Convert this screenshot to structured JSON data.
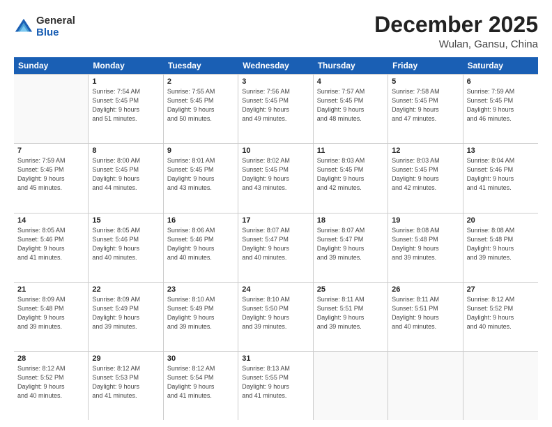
{
  "logo": {
    "general": "General",
    "blue": "Blue"
  },
  "title": "December 2025",
  "location": "Wulan, Gansu, China",
  "days_header": [
    "Sunday",
    "Monday",
    "Tuesday",
    "Wednesday",
    "Thursday",
    "Friday",
    "Saturday"
  ],
  "weeks": [
    [
      {
        "day": "",
        "info": ""
      },
      {
        "day": "1",
        "info": "Sunrise: 7:54 AM\nSunset: 5:45 PM\nDaylight: 9 hours\nand 51 minutes."
      },
      {
        "day": "2",
        "info": "Sunrise: 7:55 AM\nSunset: 5:45 PM\nDaylight: 9 hours\nand 50 minutes."
      },
      {
        "day": "3",
        "info": "Sunrise: 7:56 AM\nSunset: 5:45 PM\nDaylight: 9 hours\nand 49 minutes."
      },
      {
        "day": "4",
        "info": "Sunrise: 7:57 AM\nSunset: 5:45 PM\nDaylight: 9 hours\nand 48 minutes."
      },
      {
        "day": "5",
        "info": "Sunrise: 7:58 AM\nSunset: 5:45 PM\nDaylight: 9 hours\nand 47 minutes."
      },
      {
        "day": "6",
        "info": "Sunrise: 7:59 AM\nSunset: 5:45 PM\nDaylight: 9 hours\nand 46 minutes."
      }
    ],
    [
      {
        "day": "7",
        "info": "Sunrise: 7:59 AM\nSunset: 5:45 PM\nDaylight: 9 hours\nand 45 minutes."
      },
      {
        "day": "8",
        "info": "Sunrise: 8:00 AM\nSunset: 5:45 PM\nDaylight: 9 hours\nand 44 minutes."
      },
      {
        "day": "9",
        "info": "Sunrise: 8:01 AM\nSunset: 5:45 PM\nDaylight: 9 hours\nand 43 minutes."
      },
      {
        "day": "10",
        "info": "Sunrise: 8:02 AM\nSunset: 5:45 PM\nDaylight: 9 hours\nand 43 minutes."
      },
      {
        "day": "11",
        "info": "Sunrise: 8:03 AM\nSunset: 5:45 PM\nDaylight: 9 hours\nand 42 minutes."
      },
      {
        "day": "12",
        "info": "Sunrise: 8:03 AM\nSunset: 5:45 PM\nDaylight: 9 hours\nand 42 minutes."
      },
      {
        "day": "13",
        "info": "Sunrise: 8:04 AM\nSunset: 5:46 PM\nDaylight: 9 hours\nand 41 minutes."
      }
    ],
    [
      {
        "day": "14",
        "info": "Sunrise: 8:05 AM\nSunset: 5:46 PM\nDaylight: 9 hours\nand 41 minutes."
      },
      {
        "day": "15",
        "info": "Sunrise: 8:05 AM\nSunset: 5:46 PM\nDaylight: 9 hours\nand 40 minutes."
      },
      {
        "day": "16",
        "info": "Sunrise: 8:06 AM\nSunset: 5:46 PM\nDaylight: 9 hours\nand 40 minutes."
      },
      {
        "day": "17",
        "info": "Sunrise: 8:07 AM\nSunset: 5:47 PM\nDaylight: 9 hours\nand 40 minutes."
      },
      {
        "day": "18",
        "info": "Sunrise: 8:07 AM\nSunset: 5:47 PM\nDaylight: 9 hours\nand 39 minutes."
      },
      {
        "day": "19",
        "info": "Sunrise: 8:08 AM\nSunset: 5:48 PM\nDaylight: 9 hours\nand 39 minutes."
      },
      {
        "day": "20",
        "info": "Sunrise: 8:08 AM\nSunset: 5:48 PM\nDaylight: 9 hours\nand 39 minutes."
      }
    ],
    [
      {
        "day": "21",
        "info": "Sunrise: 8:09 AM\nSunset: 5:48 PM\nDaylight: 9 hours\nand 39 minutes."
      },
      {
        "day": "22",
        "info": "Sunrise: 8:09 AM\nSunset: 5:49 PM\nDaylight: 9 hours\nand 39 minutes."
      },
      {
        "day": "23",
        "info": "Sunrise: 8:10 AM\nSunset: 5:49 PM\nDaylight: 9 hours\nand 39 minutes."
      },
      {
        "day": "24",
        "info": "Sunrise: 8:10 AM\nSunset: 5:50 PM\nDaylight: 9 hours\nand 39 minutes."
      },
      {
        "day": "25",
        "info": "Sunrise: 8:11 AM\nSunset: 5:51 PM\nDaylight: 9 hours\nand 39 minutes."
      },
      {
        "day": "26",
        "info": "Sunrise: 8:11 AM\nSunset: 5:51 PM\nDaylight: 9 hours\nand 40 minutes."
      },
      {
        "day": "27",
        "info": "Sunrise: 8:12 AM\nSunset: 5:52 PM\nDaylight: 9 hours\nand 40 minutes."
      }
    ],
    [
      {
        "day": "28",
        "info": "Sunrise: 8:12 AM\nSunset: 5:52 PM\nDaylight: 9 hours\nand 40 minutes."
      },
      {
        "day": "29",
        "info": "Sunrise: 8:12 AM\nSunset: 5:53 PM\nDaylight: 9 hours\nand 41 minutes."
      },
      {
        "day": "30",
        "info": "Sunrise: 8:12 AM\nSunset: 5:54 PM\nDaylight: 9 hours\nand 41 minutes."
      },
      {
        "day": "31",
        "info": "Sunrise: 8:13 AM\nSunset: 5:55 PM\nDaylight: 9 hours\nand 41 minutes."
      },
      {
        "day": "",
        "info": ""
      },
      {
        "day": "",
        "info": ""
      },
      {
        "day": "",
        "info": ""
      }
    ]
  ]
}
